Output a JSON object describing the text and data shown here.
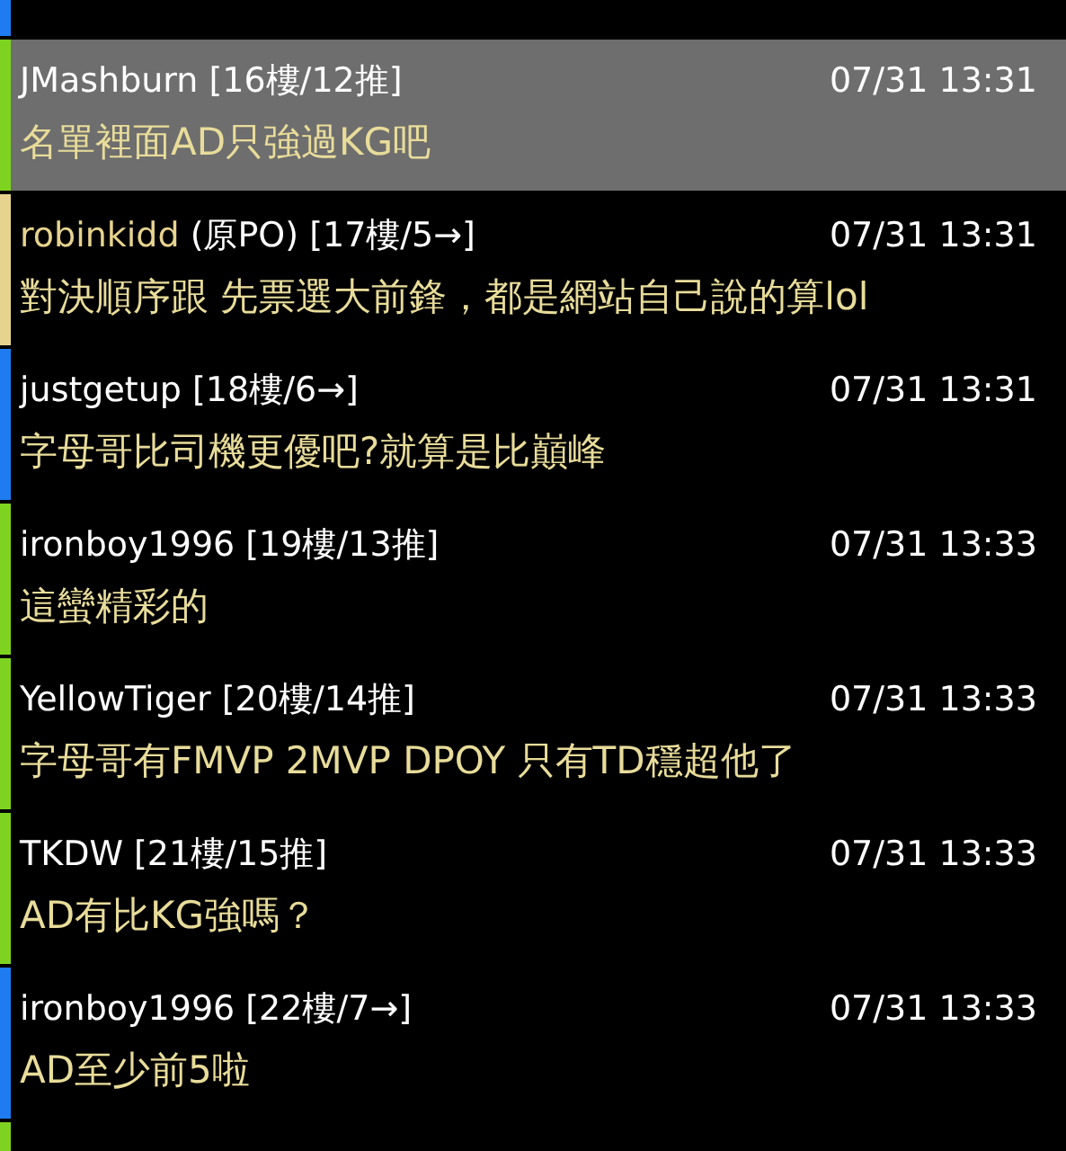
{
  "cut_off_above": {
    "color": "#1e7cf0"
  },
  "comments": [
    {
      "author": "JMashburn",
      "floor": "[16樓/12推]",
      "time": "07/31 13:31",
      "text": "名單裡面AD只強過KG吧",
      "color": "#7ed321",
      "selected": true
    },
    {
      "author": "robinkidd",
      "op_tag": "(原PO)",
      "floor": "[17樓/5→]",
      "time": "07/31 13:31",
      "text": "對決順序跟 先票選大前鋒，都是網站自己說的算lol",
      "color": "#e6d38e",
      "selected": false
    },
    {
      "author": "justgetup",
      "floor": "[18樓/6→]",
      "time": "07/31 13:31",
      "text": "字母哥比司機更優吧?就算是比巔峰",
      "color": "#1e7cf0",
      "selected": false
    },
    {
      "author": "ironboy1996",
      "floor": "[19樓/13推]",
      "time": "07/31 13:33",
      "text": "這蠻精彩的",
      "color": "#7ed321",
      "selected": false
    },
    {
      "author": "YellowTiger",
      "floor": "[20樓/14推]",
      "time": "07/31 13:33",
      "text": "字母哥有FMVP 2MVP DPOY 只有TD穩超他了",
      "color": "#7ed321",
      "selected": false
    },
    {
      "author": "TKDW",
      "floor": "[21樓/15推]",
      "time": "07/31 13:33",
      "text": "AD有比KG強嗎？",
      "color": "#7ed321",
      "selected": false
    },
    {
      "author": "ironboy1996",
      "floor": "[22樓/7→]",
      "time": "07/31 13:33",
      "text": "AD至少前5啦",
      "color": "#1e7cf0",
      "selected": false
    }
  ],
  "cut_off_below": {
    "color": "#7ed321"
  }
}
